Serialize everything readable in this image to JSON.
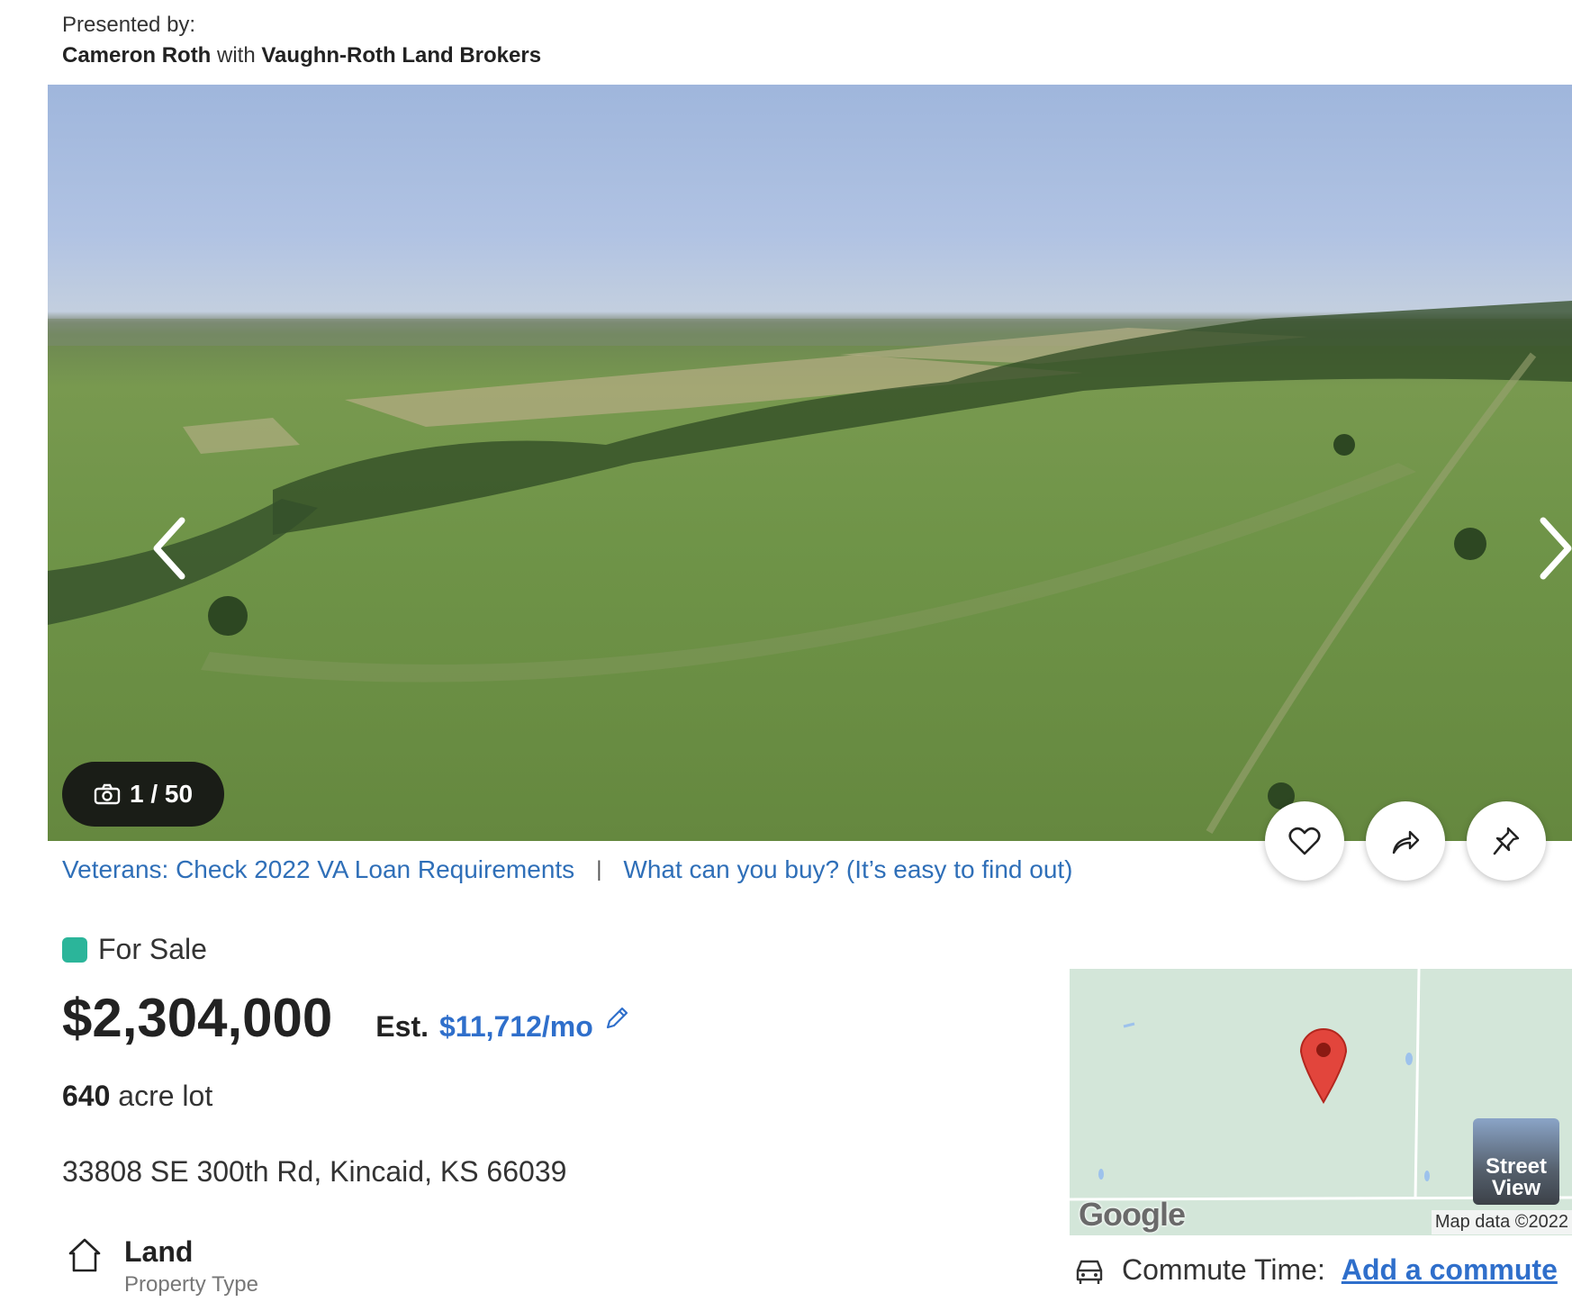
{
  "presented": {
    "label": "Presented by:",
    "agent": "Cameron Roth",
    "with": "with",
    "brokerage": "Vaughn-Roth Land Brokers"
  },
  "gallery": {
    "counter": "1 / 50",
    "icons": [
      "camera-icon",
      "chevron-left-icon",
      "chevron-right-icon"
    ]
  },
  "actions": [
    "heart-icon",
    "share-icon",
    "pin-icon"
  ],
  "promo": {
    "va_link": "Veterans: Check 2022 VA Loan Requirements",
    "separator": "|",
    "buy_link": "What can you buy? (It’s easy to find out)"
  },
  "listing": {
    "status": "For Sale",
    "status_color": "#2bb59a",
    "price": "$2,304,000",
    "est_label": "Est.",
    "est_value": "$11,712/mo",
    "lot_size": "640",
    "lot_label": "acre lot",
    "address": "33808 SE 300th Rd, Kincaid, KS 66039",
    "property_type": "Land",
    "property_type_label": "Property Type"
  },
  "map": {
    "street_view_line1": "Street",
    "street_view_line2": "View",
    "google": "Google",
    "attribution": "Map data ©2022"
  },
  "commute": {
    "label": "Commute Time:",
    "link": "Add a commute"
  },
  "colors": {
    "link": "#2f6fb8",
    "accent": "#2f6fcb"
  }
}
